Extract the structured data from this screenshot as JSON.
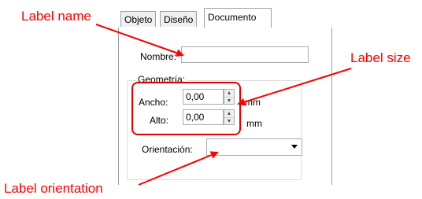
{
  "tabs": [
    "Objeto",
    "Diseño",
    "Documento"
  ],
  "fields": {
    "nombre_label": "Nombre:",
    "nombre_value": "",
    "geometria_label": "Geometría:",
    "ancho_label": "Ancho:",
    "ancho_value": "0,00",
    "alto_label": "Alto:",
    "alto_value": "0,00",
    "unit": "mm",
    "orientacion_label": "Orientación:",
    "orientacion_value": ""
  },
  "annotations": {
    "label_name": "Label name",
    "label_size": "Label size",
    "label_orientation": "Label orientation"
  },
  "colors": {
    "annotation": "#ff0000",
    "highlight": "#e00000"
  }
}
